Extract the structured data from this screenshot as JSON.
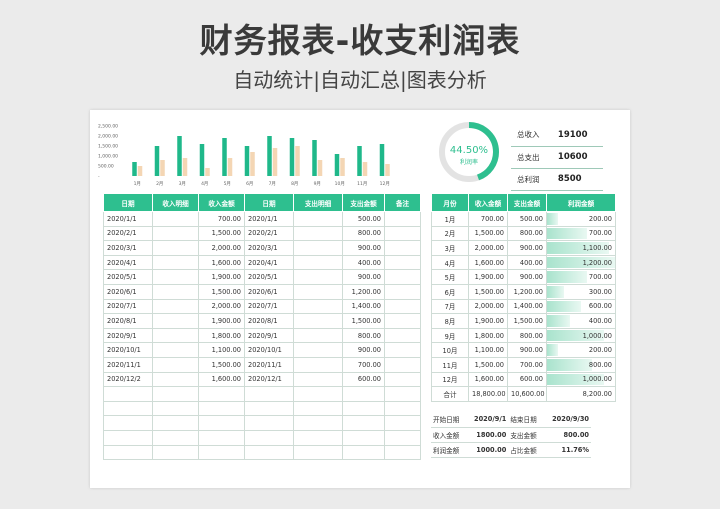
{
  "header": {
    "title": "财务报表-收支利润表",
    "subtitle": "自动统计|自动汇总|图表分析"
  },
  "colors": {
    "income": "#1fb88a",
    "expense": "#f4d6b4",
    "header": "#2ebf8f"
  },
  "chart_data": {
    "type": "bar",
    "categories": [
      "1月",
      "2月",
      "3月",
      "4月",
      "5月",
      "6月",
      "7月",
      "8月",
      "9月",
      "10月",
      "11月",
      "12月"
    ],
    "series": [
      {
        "values": [
          700,
          1500,
          2000,
          1600,
          1900,
          1500,
          2000,
          1900,
          1800,
          1100,
          1500,
          1600
        ]
      },
      {
        "values": [
          500,
          800,
          900,
          400,
          900,
          1200,
          1400,
          1500,
          800,
          900,
          700,
          600
        ]
      }
    ],
    "yticks": [
      "2,500.00",
      "2,000.00",
      "1,500.00",
      "1,000.00",
      "500.00",
      "-"
    ],
    "ylim": [
      0,
      2500
    ]
  },
  "gauge": {
    "percent": "44.50%",
    "label": "利润率",
    "fraction": 0.445
  },
  "summary": [
    {
      "label": "总收入",
      "value": "19100"
    },
    {
      "label": "总支出",
      "value": "10600"
    },
    {
      "label": "总利润",
      "value": "8500"
    }
  ],
  "left_table": {
    "headers": [
      "日期",
      "收入明细",
      "收入金额",
      "日期",
      "支出明细",
      "支出金额",
      "备注"
    ],
    "rows": [
      [
        "2020/1/1",
        "",
        "700.00",
        "2020/1/1",
        "",
        "500.00",
        ""
      ],
      [
        "2020/2/1",
        "",
        "1,500.00",
        "2020/2/1",
        "",
        "800.00",
        ""
      ],
      [
        "2020/3/1",
        "",
        "2,000.00",
        "2020/3/1",
        "",
        "900.00",
        ""
      ],
      [
        "2020/4/1",
        "",
        "1,600.00",
        "2020/4/1",
        "",
        "400.00",
        ""
      ],
      [
        "2020/5/1",
        "",
        "1,900.00",
        "2020/5/1",
        "",
        "900.00",
        ""
      ],
      [
        "2020/6/1",
        "",
        "1,500.00",
        "2020/6/1",
        "",
        "1,200.00",
        ""
      ],
      [
        "2020/7/1",
        "",
        "2,000.00",
        "2020/7/1",
        "",
        "1,400.00",
        ""
      ],
      [
        "2020/8/1",
        "",
        "1,900.00",
        "2020/8/1",
        "",
        "1,500.00",
        ""
      ],
      [
        "2020/9/1",
        "",
        "1,800.00",
        "2020/9/1",
        "",
        "800.00",
        ""
      ],
      [
        "2020/10/1",
        "",
        "1,100.00",
        "2020/10/1",
        "",
        "900.00",
        ""
      ],
      [
        "2020/11/1",
        "",
        "1,500.00",
        "2020/11/1",
        "",
        "700.00",
        ""
      ],
      [
        "2020/12/2",
        "",
        "1,600.00",
        "2020/12/1",
        "",
        "600.00",
        ""
      ],
      [
        "",
        "",
        "",
        "",
        "",
        "",
        ""
      ],
      [
        "",
        "",
        "",
        "",
        "",
        "",
        ""
      ],
      [
        "",
        "",
        "",
        "",
        "",
        "",
        ""
      ],
      [
        "",
        "",
        "",
        "",
        "",
        "",
        ""
      ],
      [
        "",
        "",
        "",
        "",
        "",
        "",
        ""
      ]
    ]
  },
  "right_table": {
    "headers": [
      "月份",
      "收入金额",
      "支出金额",
      "利润金额"
    ],
    "rows": [
      [
        "1月",
        "700.00",
        "500.00",
        "200.00"
      ],
      [
        "2月",
        "1,500.00",
        "800.00",
        "700.00"
      ],
      [
        "3月",
        "2,000.00",
        "900.00",
        "1,100.00"
      ],
      [
        "4月",
        "1,600.00",
        "400.00",
        "1,200.00"
      ],
      [
        "5月",
        "1,900.00",
        "900.00",
        "700.00"
      ],
      [
        "6月",
        "1,500.00",
        "1,200.00",
        "300.00"
      ],
      [
        "7月",
        "2,000.00",
        "1,400.00",
        "600.00"
      ],
      [
        "8月",
        "1,900.00",
        "1,500.00",
        "400.00"
      ],
      [
        "9月",
        "1,800.00",
        "800.00",
        "1,000.00"
      ],
      [
        "10月",
        "1,100.00",
        "900.00",
        "200.00"
      ],
      [
        "11月",
        "1,500.00",
        "700.00",
        "800.00"
      ],
      [
        "12月",
        "1,600.00",
        "600.00",
        "1,000.00"
      ]
    ],
    "profit_values": [
      200,
      700,
      1100,
      1200,
      700,
      300,
      600,
      400,
      1000,
      200,
      800,
      1000
    ],
    "total": [
      "合计",
      "18,800.00",
      "10,600.00",
      "8,200.00"
    ]
  },
  "info": {
    "start_label": "开始日期",
    "start_value": "2020/9/1",
    "end_label": "结束日期",
    "end_value": "2020/9/30",
    "income_label": "收入金额",
    "income_value": "1800.00",
    "expense_label": "支出金额",
    "expense_value": "800.00",
    "profit_label": "利润金额",
    "profit_value": "1000.00",
    "ratio_label": "占比金额",
    "ratio_value": "11.76%"
  }
}
